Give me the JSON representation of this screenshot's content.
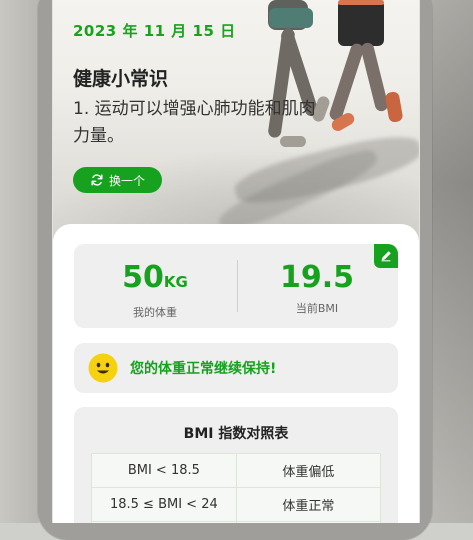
{
  "header": {
    "date": "2023 年 11 月 15 日"
  },
  "tip": {
    "title": "健康小常识",
    "text": "1. 运动可以增强心肺功能和肌肉力量。",
    "change_label": "换一个"
  },
  "stats": {
    "weight_value": "50",
    "weight_unit": "KG",
    "weight_label": "我的体重",
    "bmi_value": "19.5",
    "bmi_label": "当前BMI"
  },
  "status": {
    "message": "您的体重正常继续保持!"
  },
  "bmi_table": {
    "title": "BMI 指数对照表",
    "rows": [
      {
        "range": "BMI < 18.5",
        "category": "体重偏低"
      },
      {
        "range": "18.5 ≤ BMI < 24",
        "category": "体重正常"
      }
    ]
  },
  "icons": {
    "refresh": "refresh-icon",
    "edit": "pencil-icon",
    "smiley": "smiley-face-icon"
  },
  "colors": {
    "accent": "#16a11e",
    "smiley": "#f5d10f"
  }
}
